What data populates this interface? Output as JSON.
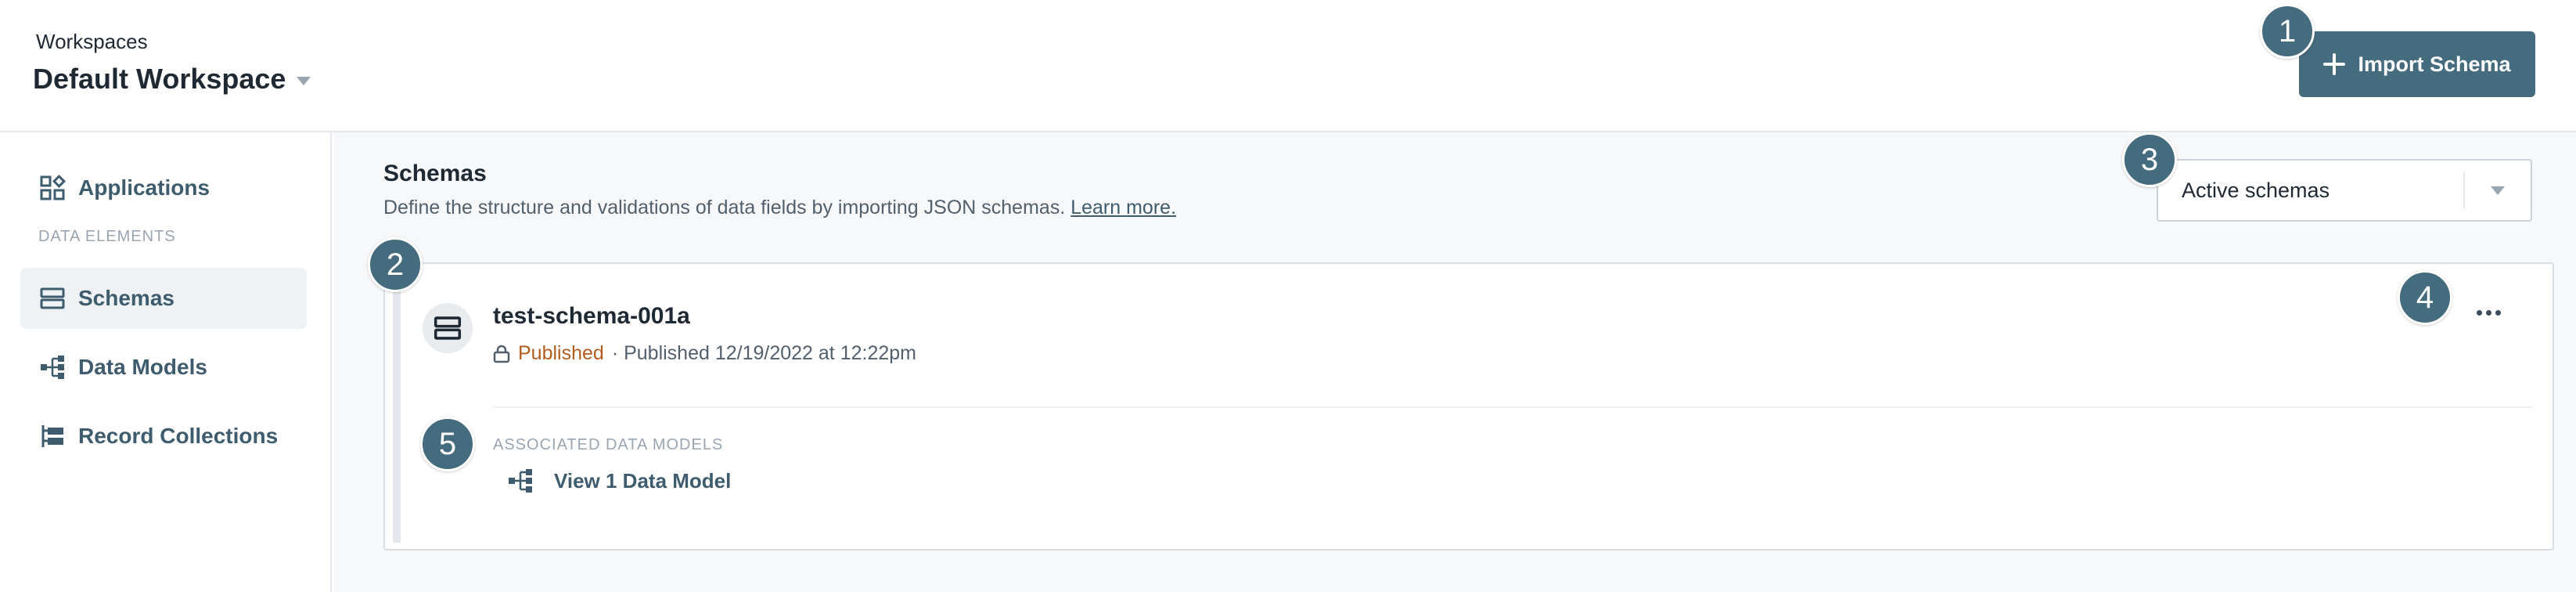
{
  "header": {
    "workspaces_label": "Workspaces",
    "workspace_name": "Default Workspace",
    "import_button": "Import Schema"
  },
  "sidebar": {
    "items": [
      {
        "label": "Applications",
        "icon": "applications-icon",
        "active": false
      },
      {
        "label": "Schemas",
        "icon": "schemas-icon",
        "active": true
      },
      {
        "label": "Data Models",
        "icon": "data-models-icon",
        "active": false
      },
      {
        "label": "Record Collections",
        "icon": "record-collections-icon",
        "active": false
      }
    ],
    "section_heading": "DATA ELEMENTS"
  },
  "main": {
    "title": "Schemas",
    "description": "Define the structure and validations of data fields by importing JSON schemas.",
    "learn_more": "Learn more.",
    "filter": {
      "selected": "Active schemas"
    },
    "schema": {
      "name": "test-schema-001a",
      "status": "Published",
      "published_info": "· Published 12/19/2022 at 12:22pm",
      "associated_heading": "ASSOCIATED DATA MODELS",
      "view_link": "View 1 Data Model"
    }
  },
  "callouts": [
    "1",
    "2",
    "3",
    "4",
    "5"
  ],
  "colors": {
    "accent": "#456b7f",
    "status_published": "#b35c1e",
    "link": "#3e5c6e"
  }
}
